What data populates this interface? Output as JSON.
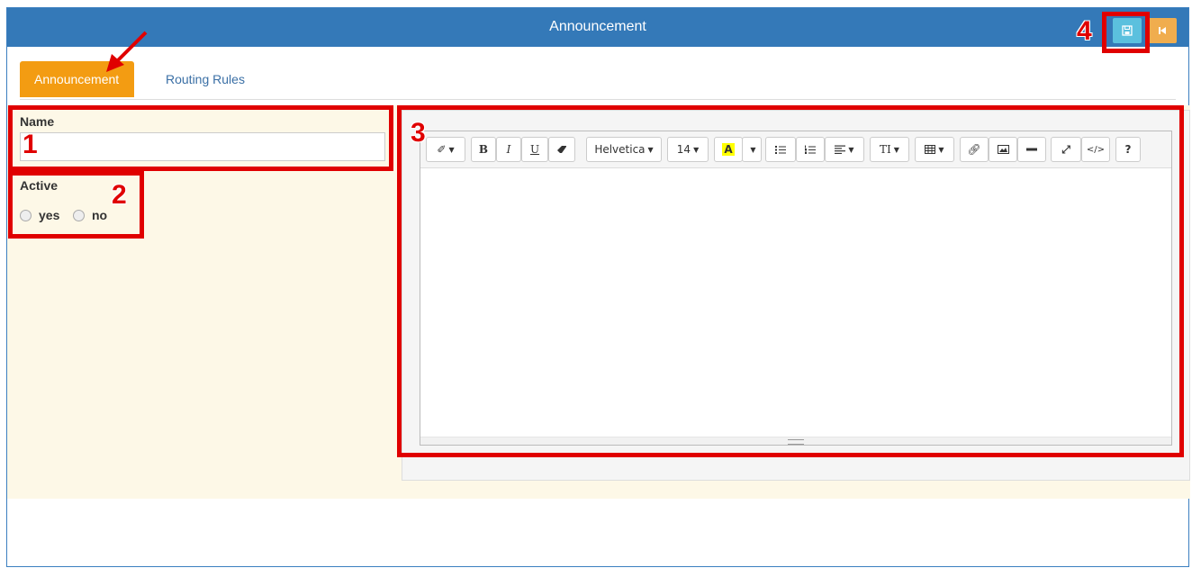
{
  "window": {
    "title": "Announcement"
  },
  "header_buttons": {
    "save_icon": "save-icon",
    "back_icon": "skip-back-icon"
  },
  "tabs": [
    {
      "label": "Announcement",
      "active": true
    },
    {
      "label": "Routing Rules",
      "active": false
    }
  ],
  "form": {
    "name_label": "Name",
    "name_value": "",
    "active_label": "Active",
    "active_options": [
      {
        "label": "yes",
        "checked": false
      },
      {
        "label": "no",
        "checked": false
      }
    ]
  },
  "editor": {
    "font_family": "Helvetica",
    "font_size": "14",
    "highlight_letter": "A",
    "style_label": "TΙ",
    "help_label": "?"
  },
  "callouts": [
    "1",
    "2",
    "3",
    "4"
  ],
  "colors": {
    "header": "#3479b8",
    "active_tab": "#f39c12",
    "save_button": "#5bc0de",
    "back_button": "#f0ad4e",
    "annotation": "#e00000"
  }
}
